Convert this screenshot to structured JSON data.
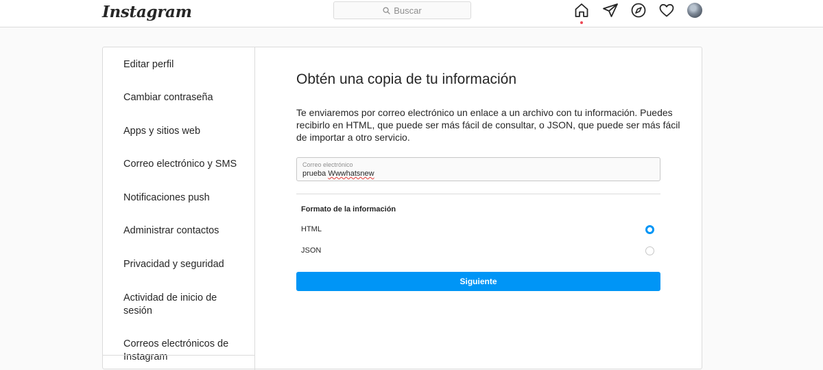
{
  "header": {
    "logo": "Instagram",
    "search": {
      "placeholder": "Buscar"
    },
    "icons": [
      "home-icon",
      "direct-icon",
      "explore-icon",
      "heart-icon",
      "avatar"
    ]
  },
  "sidebar": {
    "items": [
      {
        "label": "Editar perfil"
      },
      {
        "label": "Cambiar contraseña"
      },
      {
        "label": "Apps y sitios web"
      },
      {
        "label": "Correo electrónico y SMS"
      },
      {
        "label": "Notificaciones push"
      },
      {
        "label": "Administrar contactos"
      },
      {
        "label": "Privacidad y seguridad"
      },
      {
        "label": "Actividad de inicio de sesión"
      },
      {
        "label": "Correos electrónicos de Instagram"
      }
    ]
  },
  "main": {
    "title": "Obtén una copia de tu información",
    "description": "Te enviaremos por correo electrónico un enlace a un archivo con tu información. Puedes recibirlo en HTML, que puede ser más fácil de consultar, o JSON, que puede ser más fácil de importar a otro servicio.",
    "email": {
      "label": "Correo electrónico",
      "value_prefix": "prueba ",
      "value_flagged": "Wwwhatsnew"
    },
    "format": {
      "heading": "Formato de la información",
      "options": [
        {
          "label": "HTML",
          "selected": true
        },
        {
          "label": "JSON",
          "selected": false
        }
      ]
    },
    "next_label": "Siguiente"
  },
  "colors": {
    "accent": "#0095f6",
    "border": "#dbdbdb",
    "notification_dot": "#ed4956"
  }
}
